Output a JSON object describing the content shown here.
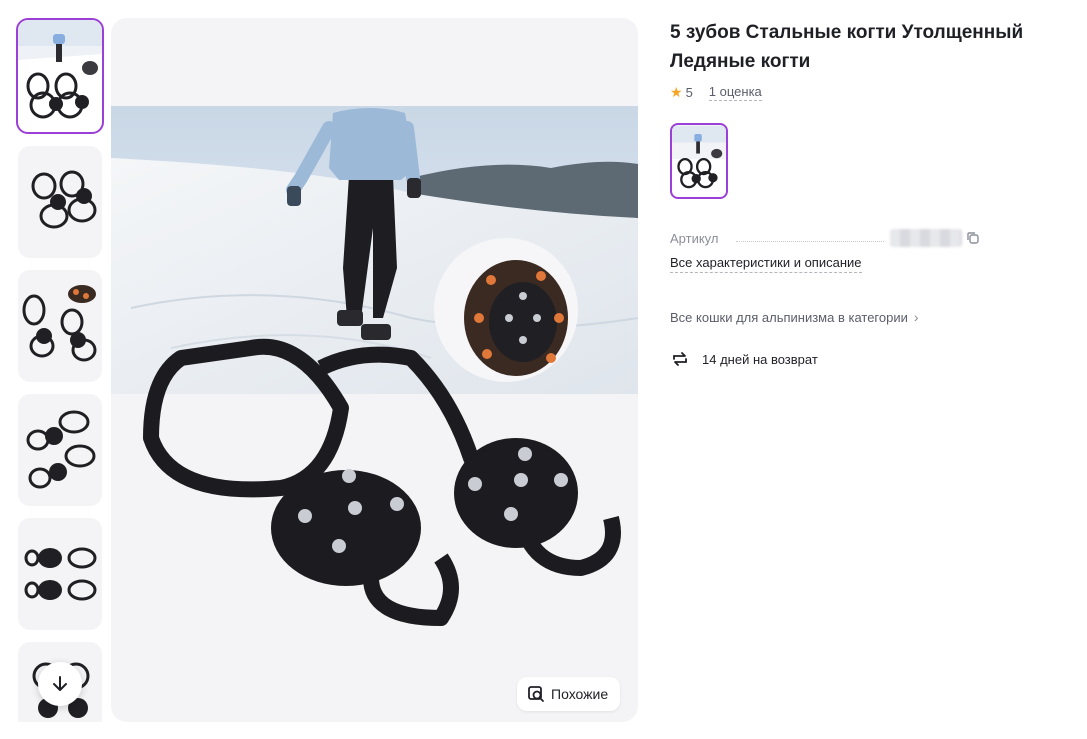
{
  "product": {
    "title": "5 зубов Стальные когти Утолщенный Ледяные когти",
    "rating": "5",
    "reviews": "1 оценка",
    "article_label": "Артикул",
    "all_specs": "Все характеристики и описание",
    "category_link": "Все кошки для альпинизма в категории",
    "return_text": "14 дней на возврат"
  },
  "gallery": {
    "similar_label": "Похожие",
    "thumbnails": [
      "ice-cleats-on-snow",
      "ice-cleats-pair",
      "ice-cleats-with-shoe",
      "ice-cleats-angled",
      "ice-cleats-side",
      "ice-cleats-detail"
    ]
  },
  "colors": {
    "accent": "#9b3fd6",
    "star": "#f5a623"
  }
}
